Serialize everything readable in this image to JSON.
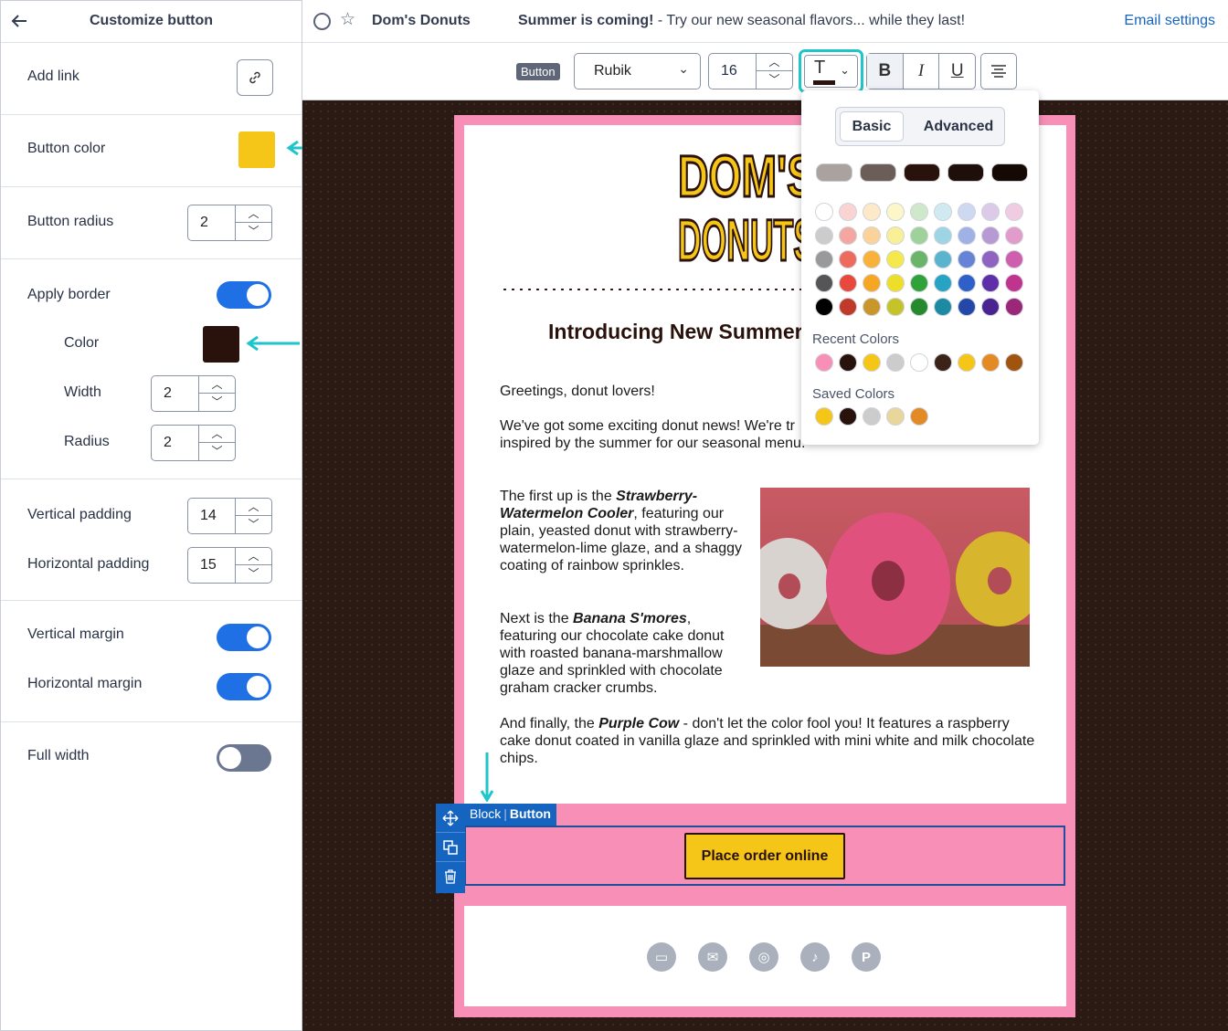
{
  "left_panel": {
    "title": "Customize button",
    "add_link_label": "Add link",
    "button_color_label": "Button color",
    "button_color": "#f5c518",
    "button_radius_label": "Button radius",
    "button_radius_value": "2",
    "apply_border_label": "Apply border",
    "apply_border_on": true,
    "border_color_label": "Color",
    "border_color": "#2a120c",
    "border_width_label": "Width",
    "border_width_value": "2",
    "border_radius_label": "Radius",
    "border_radius_value": "2",
    "vertical_padding_label": "Vertical padding",
    "vertical_padding_value": "14",
    "horizontal_padding_label": "Horizontal padding",
    "horizontal_padding_value": "15",
    "vertical_margin_label": "Vertical margin",
    "vertical_margin_on": true,
    "horizontal_margin_label": "Horizontal margin",
    "horizontal_margin_on": true,
    "full_width_label": "Full width",
    "full_width_on": false
  },
  "topbar": {
    "email_name": "Dom's Donuts",
    "subject_bold": "Summer is coming!",
    "subject_rest": " - Try our new seasonal flavors... while they last!",
    "settings_link": "Email settings"
  },
  "toolbar": {
    "badge": "Button",
    "font": "Rubik",
    "font_size": "16",
    "text_color_glyph": "T",
    "bold": "B",
    "italic": "I",
    "underline": "U"
  },
  "email": {
    "logo_line1": "DOM'S",
    "logo_line2": "DONUTS",
    "heading": "Introducing New Summer",
    "greeting": "Greetings, donut lovers!",
    "news_line1": "We've got some exciting donut news! We're tr",
    "news_line2": "inspired by the summer for our seasonal menu.",
    "p1_prefix": "The first up is the ",
    "p1_name": "Strawberry-Watermelon Cooler",
    "p1_rest": ", featuring our plain, yeasted donut with strawberry-watermelon-lime glaze, and a shaggy coating of rainbow sprinkles.",
    "p2_prefix": "Next is the ",
    "p2_name": "Banana S'mores",
    "p2_rest": ", featuring our chocolate cake donut with roasted banana-marshmallow glaze and sprinkled with chocolate graham cracker crumbs.",
    "p3_prefix": "And finally, the ",
    "p3_name": "Purple Cow",
    "p3_rest": " - don't let the color fool you! It features a raspberry cake donut coated in vanilla glaze and sprinkled with mini white and milk chocolate chips.",
    "block_label_1": "Block",
    "block_label_2": "Button",
    "cta": "Place order online",
    "social_icons": [
      "website-icon",
      "email-icon",
      "instagram-icon",
      "tiktok-icon",
      "pinterest-icon"
    ]
  },
  "color_picker": {
    "tab_basic": "Basic",
    "tab_advanced": "Advanced",
    "theme_colors": [
      "#a9a29f",
      "#6b5e58",
      "#2a120c",
      "#1f0f0a",
      "#150905"
    ],
    "grid": [
      [
        "#ffffff",
        "#f9d4d2",
        "#fde9c8",
        "#fbf7c9",
        "#cfe8cc",
        "#cfeaf1",
        "#cfd8f1",
        "#dccbe8",
        "#f0cce3"
      ],
      [
        "#cccccc",
        "#f4a7a1",
        "#fbd39a",
        "#f8ef96",
        "#9fd19b",
        "#9ed5e4",
        "#9fb1e5",
        "#b79ad4",
        "#e19ccb"
      ],
      [
        "#999999",
        "#ee6a5e",
        "#f8b23a",
        "#f5e84a",
        "#6ab56a",
        "#5ab4cf",
        "#6684d6",
        "#8e64c0",
        "#cf5fae"
      ],
      [
        "#555555",
        "#e74a3c",
        "#f5a623",
        "#eede2a",
        "#2fa23a",
        "#27a3c4",
        "#2f5fc9",
        "#5e2fa8",
        "#c0348f"
      ],
      [
        "#000000",
        "#c0392b",
        "#c8962a",
        "#c6c22a",
        "#248a2c",
        "#1d8aa3",
        "#2447a8",
        "#4a2390",
        "#9c2677"
      ]
    ],
    "recent_label": "Recent Colors",
    "recent": [
      "#f78fb6",
      "#2a120c",
      "#f5c518",
      "#cccccc",
      "#ffffff",
      "#3b2318",
      "#f5c518",
      "#e38a25",
      "#a0540f"
    ],
    "saved_label": "Saved Colors",
    "saved": [
      "#f5c518",
      "#2a120c",
      "#cccccc",
      "#e8d69a",
      "#e38a25"
    ]
  }
}
